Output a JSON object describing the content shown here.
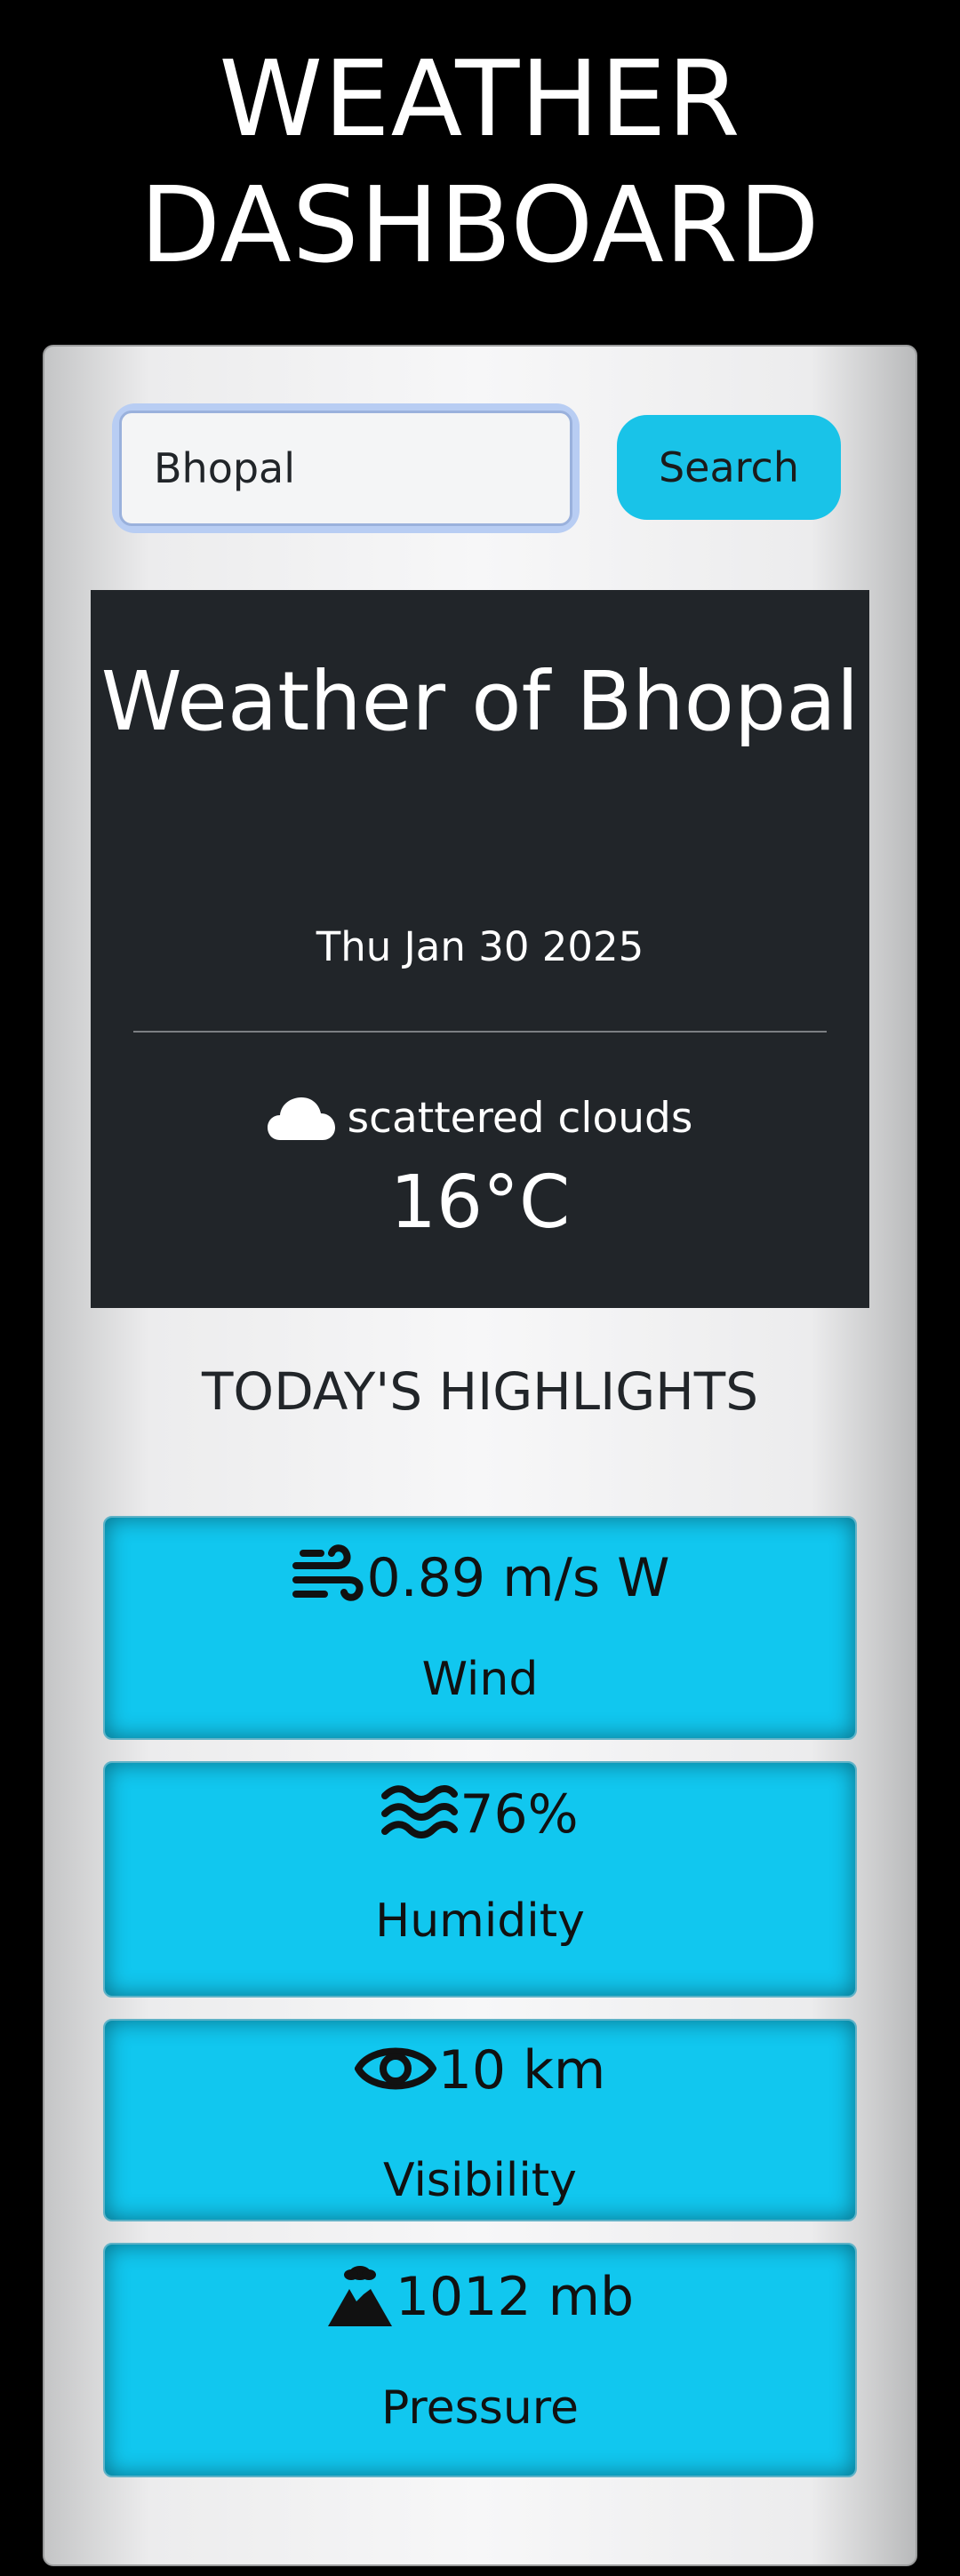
{
  "app": {
    "title": "WEATHER DASHBOARD"
  },
  "search": {
    "value": "Bhopal",
    "button_label": "Search"
  },
  "current": {
    "title": "Weather of Bhopal",
    "date": "Thu Jan 30 2025",
    "condition_icon": "cloud-icon",
    "condition": "scattered clouds",
    "temperature": "16°C"
  },
  "highlights": {
    "title": "TODAY'S HIGHLIGHTS",
    "items": [
      {
        "icon": "wind-icon",
        "value": "0.89 m/s W",
        "label": "Wind"
      },
      {
        "icon": "water-icon",
        "value": "76%",
        "label": "Humidity"
      },
      {
        "icon": "eye-icon",
        "value": "10 km",
        "label": "Visibility"
      },
      {
        "icon": "volcano-icon",
        "value": "1012 mb",
        "label": "Pressure"
      }
    ]
  },
  "colors": {
    "background": "#000000",
    "card_dark": "#212529",
    "accent": "#11c7ef",
    "button": "#19c3e8"
  }
}
